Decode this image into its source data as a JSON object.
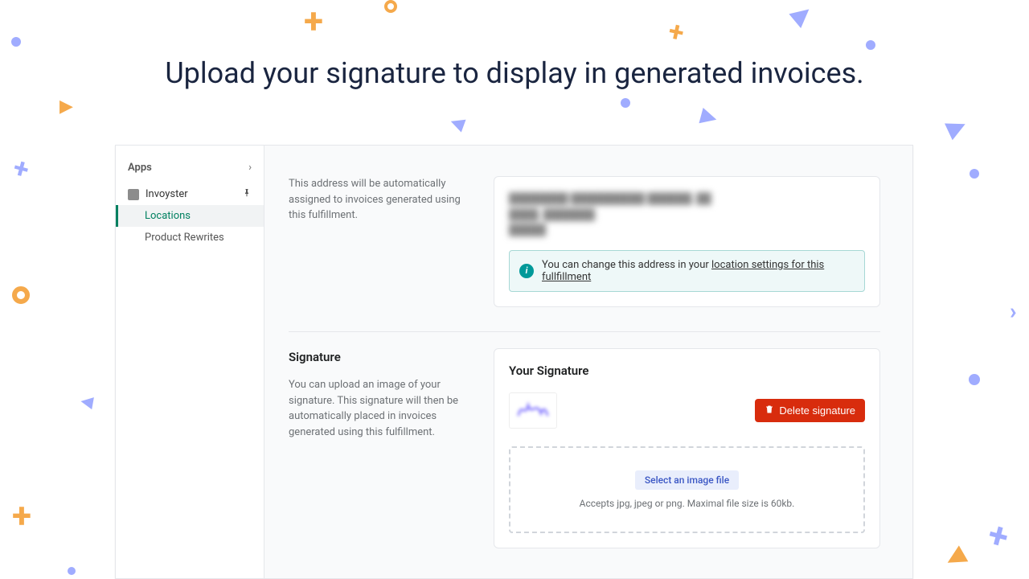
{
  "headline": "Upload your signature to display in generated invoices.",
  "sidebar": {
    "header": "Apps",
    "appName": "Invoyster",
    "items": [
      "Locations",
      "Product Rewrites"
    ],
    "activeIndex": 0
  },
  "addressSection": {
    "description": "This address will be automatically assigned to invoices generated using this fulfillment.",
    "blurredLines": "████████ ██████████ ██████, ██\n████, ███████\n█████",
    "banner": {
      "prefix": "You can change this address in your ",
      "link": "location settings for this fullfillment"
    }
  },
  "signatureSection": {
    "title": "Signature",
    "description": "You can upload an image of your signature. This signature will then be automatically placed in invoices generated using this fulfillment.",
    "cardTitle": "Your Signature",
    "deleteLabel": "Delete signature",
    "selectLabel": "Select an image file",
    "hint": "Accepts jpg, jpeg or png. Maximal file size is 60kb."
  }
}
